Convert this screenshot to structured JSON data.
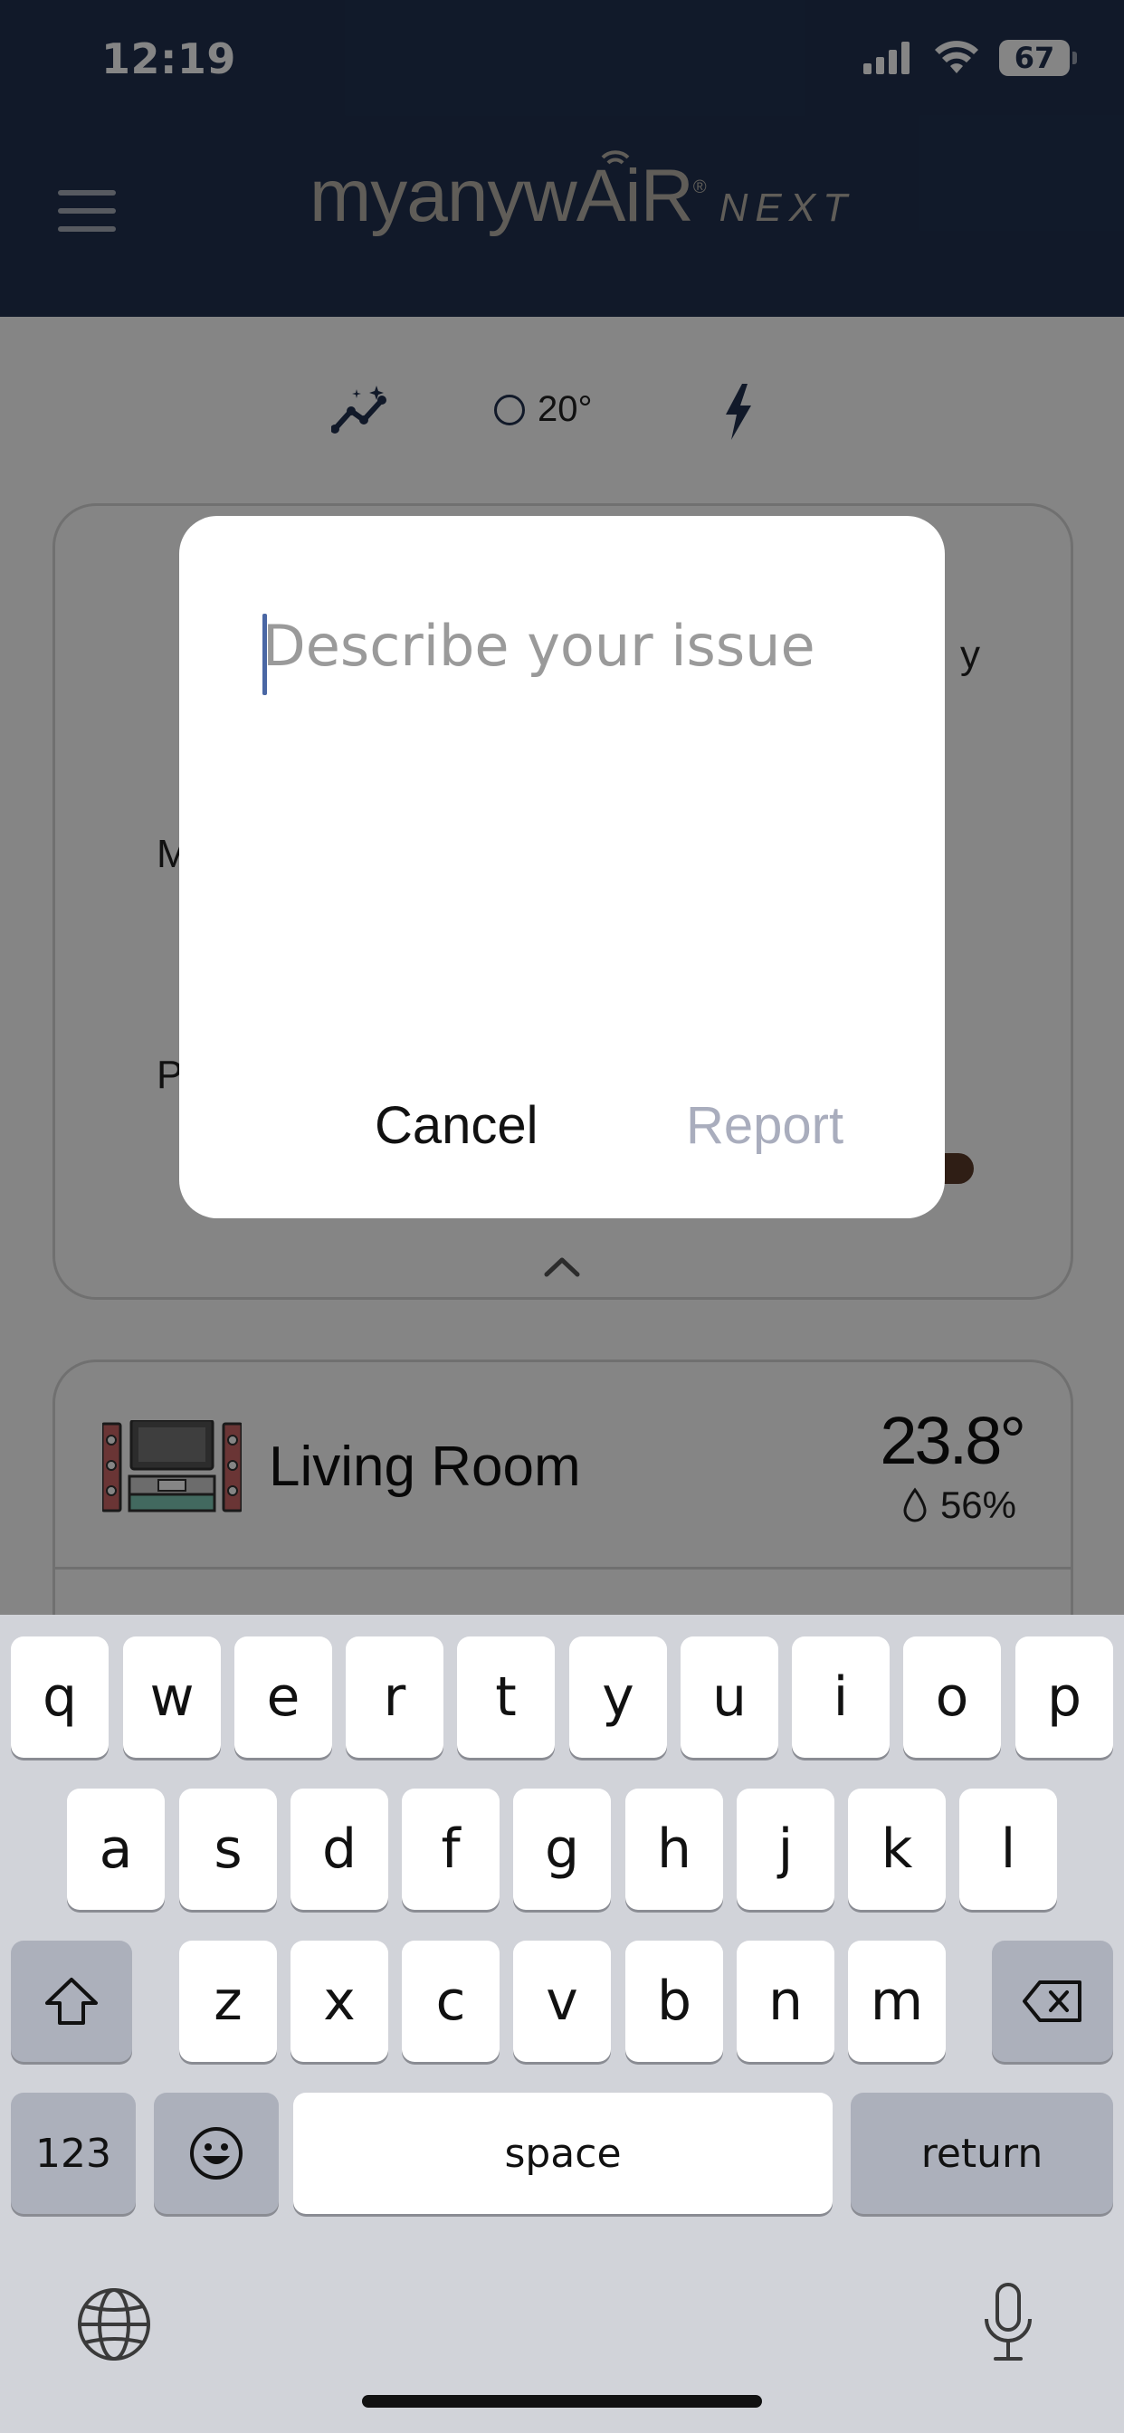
{
  "status_bar": {
    "time": "12:19",
    "battery": "67"
  },
  "header": {
    "menu_icon": "hamburger-menu-icon",
    "logo_main": "myanywAiR",
    "logo_registered": "®",
    "logo_next": "NEXT"
  },
  "quick_bar": {
    "trend_icon": "sparkle-trend-icon",
    "temperature_icon": "circle-icon",
    "temperature": "20°",
    "bolt_icon": "lightning-bolt-icon"
  },
  "main_card": {
    "partial_text_right": "y",
    "partial_text_m": "M",
    "partial_text_p": "P"
  },
  "room_card": {
    "name": "Living Room",
    "temperature": "23.8°",
    "humidity": "56%",
    "humidity_icon": "water-drop-icon"
  },
  "dialog": {
    "placeholder": "Describe your issue",
    "value": "",
    "cancel_label": "Cancel",
    "report_label": "Report"
  },
  "keyboard": {
    "row1": [
      "q",
      "w",
      "e",
      "r",
      "t",
      "y",
      "u",
      "i",
      "o",
      "p"
    ],
    "row2": [
      "a",
      "s",
      "d",
      "f",
      "g",
      "h",
      "j",
      "k",
      "l"
    ],
    "row3": [
      "z",
      "x",
      "c",
      "v",
      "b",
      "n",
      "m"
    ],
    "numbers_key": "123",
    "space_key": "space",
    "return_key": "return",
    "shift_icon": "shift-icon",
    "delete_icon": "delete-icon",
    "emoji_icon": "emoji-icon",
    "globe_icon": "globe-icon",
    "mic_icon": "microphone-icon"
  }
}
